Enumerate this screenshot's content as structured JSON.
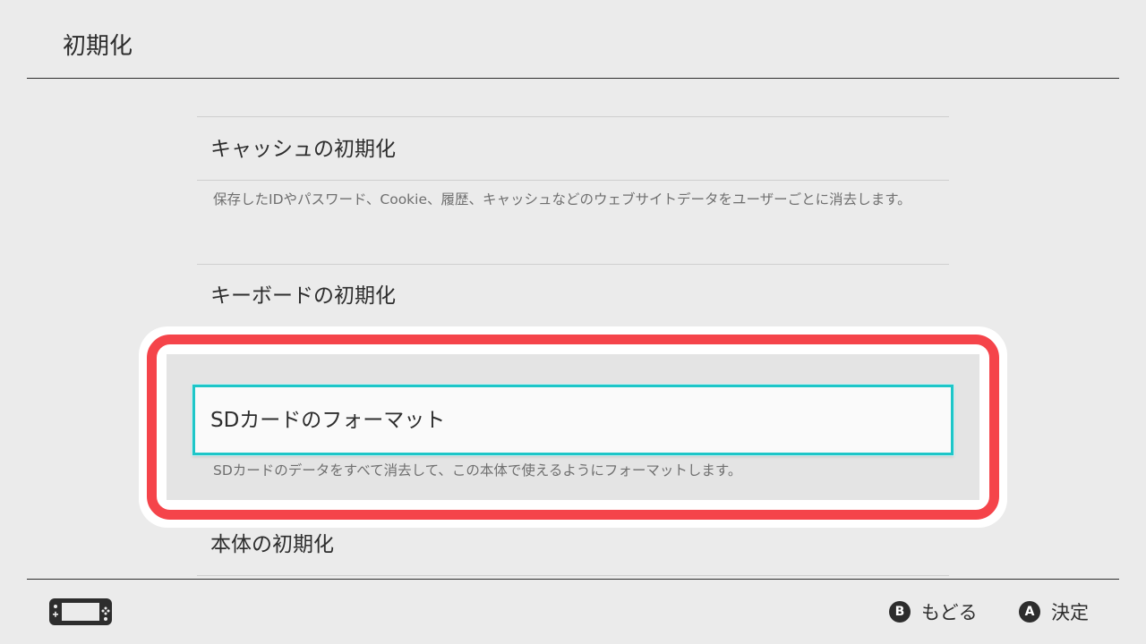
{
  "header": {
    "title": "初期化"
  },
  "items": [
    {
      "label": "キャッシュの初期化",
      "description": "保存したIDやパスワード、Cookie、履歴、キャッシュなどのウェブサイトデータをユーザーごとに消去します。"
    },
    {
      "label": "キーボードの初期化"
    },
    {
      "label": "SDカードのフォーマット",
      "description": "SDカードのデータをすべて消去して、この本体で使えるようにフォーマットします。",
      "selected": true
    },
    {
      "label": "本体の初期化"
    }
  ],
  "footer": {
    "device_icon": "handheld-console-icon",
    "back": {
      "key": "B",
      "label": "もどる"
    },
    "confirm": {
      "key": "A",
      "label": "決定"
    }
  },
  "colors": {
    "background": "#ebebeb",
    "selection_border": "#1ec6c8",
    "highlight_annotation": "#f5444a",
    "text": "#2d2d2d",
    "description_text": "#6f6f6f"
  }
}
